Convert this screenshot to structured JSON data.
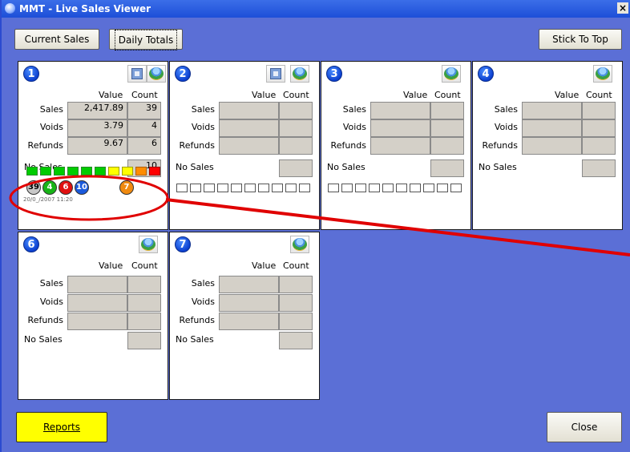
{
  "window": {
    "title": "MMT - Live Sales Viewer",
    "close_glyph": "×"
  },
  "toolbar": {
    "current_sales": "Current Sales",
    "daily_totals": "Daily Totals",
    "stick_to_top": "Stick To Top"
  },
  "footer": {
    "reports": "Reports",
    "close": "Close"
  },
  "labels": {
    "value": "Value",
    "count": "Count",
    "sales": "Sales",
    "voids": "Voids",
    "refunds": "Refunds",
    "no_sales": "No Sales"
  },
  "panels": [
    {
      "number": "1",
      "sales_value": "2,417.89",
      "sales_count": "39",
      "voids_value": "3.79",
      "voids_count": "4",
      "refunds_value": "9.67",
      "refunds_count": "6",
      "no_sales_count": "10",
      "status_circles": [
        "39",
        "4",
        "6",
        "10",
        "7"
      ],
      "timestamp": "20/0_/2007 11:20"
    },
    {
      "number": "2"
    },
    {
      "number": "3"
    },
    {
      "number": "4"
    },
    {
      "number": "6"
    },
    {
      "number": "7"
    }
  ],
  "colors": {
    "background": "#5b6fd6",
    "titlebar": "#1d4fd8",
    "reports_button": "#ffff00",
    "annotation": "#e00000",
    "panel_cell": "#d4d0c8"
  },
  "icons": {
    "window": "globe-icon",
    "print": "print-icon",
    "graph": "globe-chart-icon"
  }
}
